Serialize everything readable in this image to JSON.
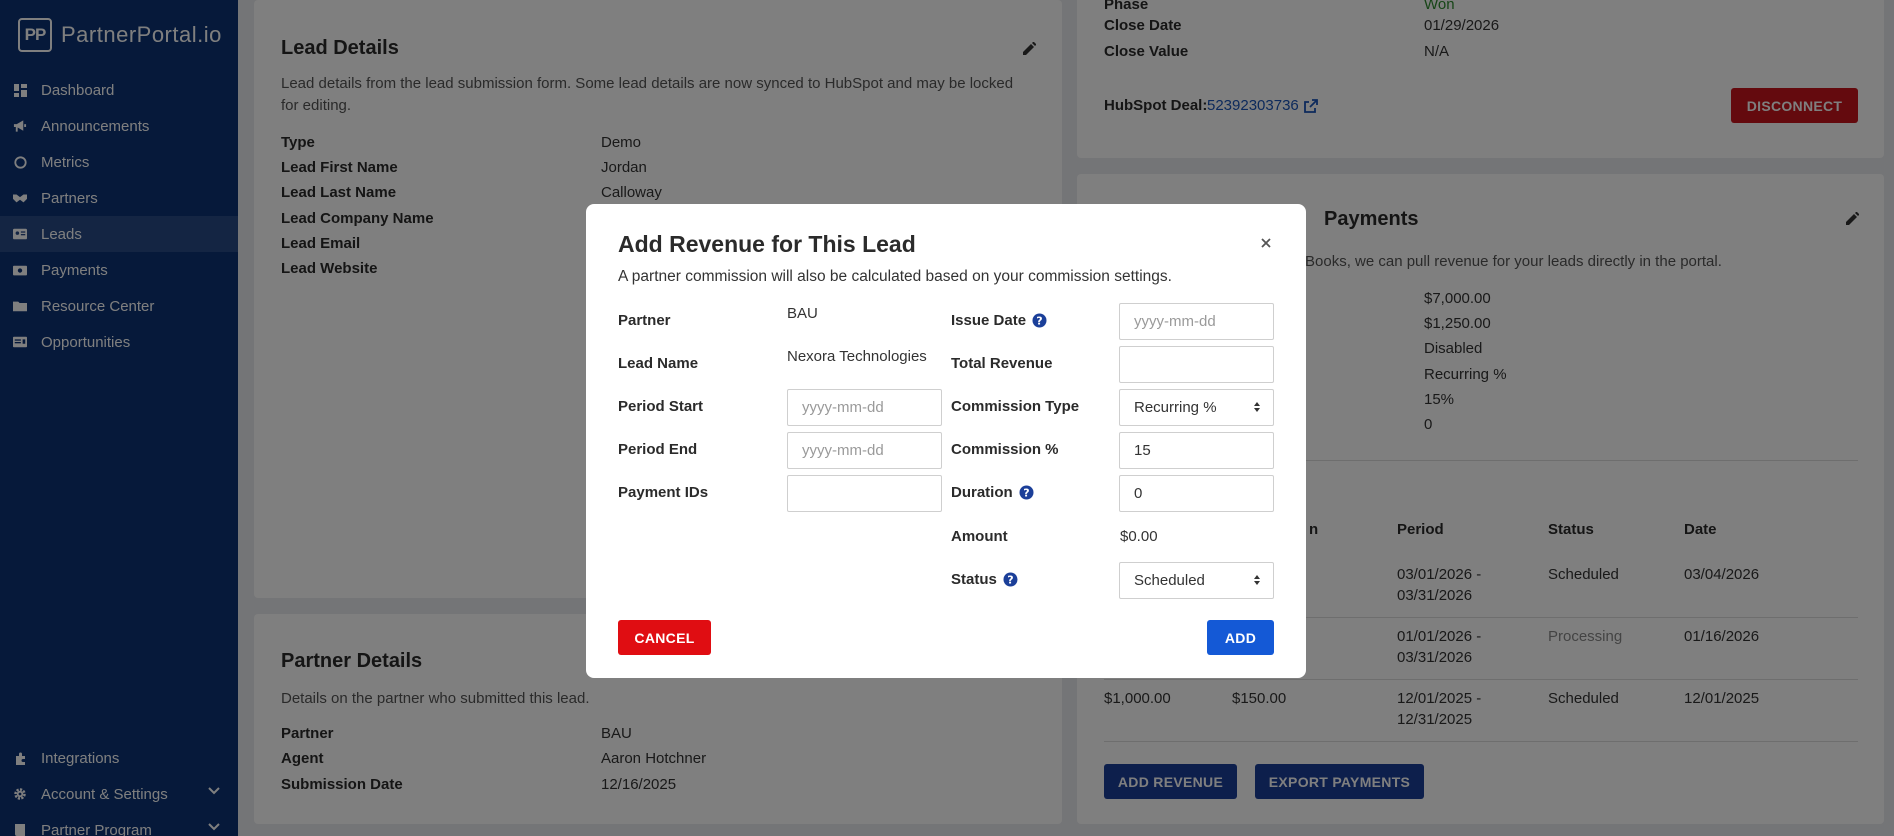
{
  "sidebar": {
    "logo_mark": "PP",
    "logo_text": "PartnerPortal.io",
    "items": [
      {
        "label": "Dashboard",
        "icon": "dashboard-icon"
      },
      {
        "label": "Announcements",
        "icon": "megaphone-icon"
      },
      {
        "label": "Metrics",
        "icon": "circle-icon"
      },
      {
        "label": "Partners",
        "icon": "handshake-icon"
      },
      {
        "label": "Leads",
        "icon": "id-card-icon",
        "active": true
      },
      {
        "label": "Payments",
        "icon": "money-icon"
      },
      {
        "label": "Resource Center",
        "icon": "folder-icon"
      },
      {
        "label": "Opportunities",
        "icon": "ticket-icon"
      }
    ],
    "bottom_items": [
      {
        "label": "Integrations",
        "icon": "puzzle-icon"
      },
      {
        "label": "Account & Settings",
        "icon": "gear-icon"
      },
      {
        "label": "Partner Program",
        "icon": "book-icon"
      }
    ]
  },
  "lead_details": {
    "title": "Lead Details",
    "description_line1": "Lead details from the lead submission form. Some lead details are now synced to HubSpot and may be locked",
    "description_line2": "for editing.",
    "fields": [
      {
        "label": "Type",
        "value": "Demo"
      },
      {
        "label": "Lead First Name",
        "value": "Jordan"
      },
      {
        "label": "Lead Last Name",
        "value": "Calloway"
      },
      {
        "label": "Lead Company Name",
        "value": ""
      },
      {
        "label": "Lead Email",
        "value": ""
      },
      {
        "label": "Lead Website",
        "value": ""
      }
    ]
  },
  "partner_details": {
    "title": "Partner Details",
    "description": "Details on the partner who submitted this lead.",
    "fields": [
      {
        "label": "Partner",
        "value": "BAU"
      },
      {
        "label": "Agent",
        "value": "Aaron Hotchner"
      },
      {
        "label": "Submission Date",
        "value": "12/16/2025"
      }
    ]
  },
  "deal": {
    "fields": [
      {
        "label": "Phase",
        "value": "Won"
      },
      {
        "label": "Close Date",
        "value": "01/29/2026"
      },
      {
        "label": "Close Value",
        "value": "N/A"
      }
    ],
    "hubspot_label": "HubSpot Deal:",
    "hubspot_id": "52392303736",
    "disconnect_label": "DISCONNECT"
  },
  "payments": {
    "title_visible": "Payments",
    "description_visible": "Books, we can pull revenue for your leads directly in the portal.",
    "values": [
      "$7,000.00",
      "$1,250.00",
      "Disabled",
      "Recurring %",
      "15%",
      "0"
    ],
    "table": {
      "headers": {
        "commission_partial": "n",
        "period": "Period",
        "status": "Status",
        "date": "Date"
      },
      "rows": [
        {
          "revenue": "",
          "commission": "",
          "period1": "03/01/2026 -",
          "period2": "03/31/2026",
          "status": "Scheduled",
          "date": "03/04/2026"
        },
        {
          "revenue": "",
          "commission": "",
          "period1": "01/01/2026 -",
          "period2": "03/31/2026",
          "status": "Processing",
          "date": "01/16/2026"
        },
        {
          "revenue": "$1,000.00",
          "commission": "$150.00",
          "period1": "12/01/2025 -",
          "period2": "12/31/2025",
          "status": "Scheduled",
          "date": "12/01/2025"
        }
      ]
    },
    "add_revenue_label": "ADD REVENUE",
    "export_payments_label": "EXPORT PAYMENTS"
  },
  "modal": {
    "title": "Add Revenue for This Lead",
    "subtitle": "A partner commission will also be calculated based on your commission settings.",
    "partner_label": "Partner",
    "partner_value": "BAU",
    "lead_name_label": "Lead Name",
    "lead_name_value": "Nexora Technologies",
    "period_start_label": "Period Start",
    "period_start_placeholder": "yyyy-mm-dd",
    "period_end_label": "Period End",
    "period_end_placeholder": "yyyy-mm-dd",
    "payment_ids_label": "Payment IDs",
    "payment_ids_value": "",
    "issue_date_label": "Issue Date",
    "issue_date_placeholder": "yyyy-mm-dd",
    "total_revenue_label": "Total Revenue",
    "total_revenue_value": "",
    "commission_type_label": "Commission Type",
    "commission_type_value": "Recurring %",
    "commission_pct_label": "Commission %",
    "commission_pct_value": "15",
    "duration_label": "Duration",
    "duration_value": "0",
    "amount_label": "Amount",
    "amount_value": "$0.00",
    "status_label": "Status",
    "status_value": "Scheduled",
    "cancel_label": "CANCEL",
    "add_label": "ADD"
  },
  "colors": {
    "sidebar": "#0c3375",
    "primary": "#1b3f99",
    "danger": "#c8151d",
    "link": "#1b55b8",
    "won": "#2e8b2e"
  }
}
